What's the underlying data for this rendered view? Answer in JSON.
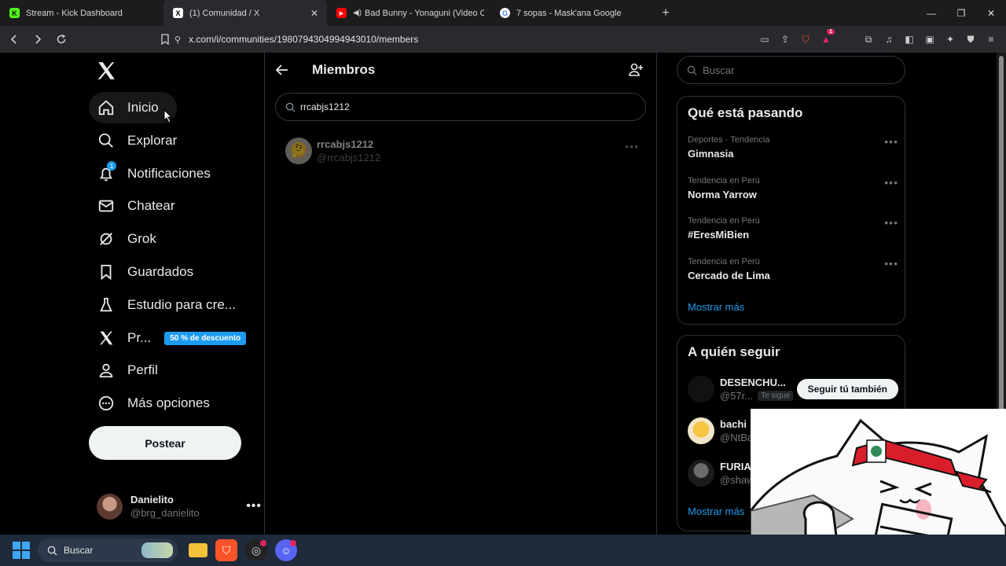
{
  "browser": {
    "tabs": [
      {
        "title": "Stream - Kick Dashboard",
        "favicon": "kick-icon",
        "color": "#53fc18",
        "active": false
      },
      {
        "title": "(1) Comunidad / X",
        "favicon": "x-icon",
        "color": "#ffffff",
        "active": true
      },
      {
        "title": "Bad Bunny - Yonaguni (Video Ofi",
        "favicon": "youtube-icon",
        "color": "#ff0000",
        "active": false
      },
      {
        "title": "7 sopas - Mask'ana Google",
        "favicon": "google-icon",
        "color": "#4285f4",
        "active": false
      }
    ],
    "url": "x.com/i/communities/1980794304994943010/members",
    "shield_badge": "1"
  },
  "nav": {
    "items": [
      {
        "label": "Inicio",
        "icon": "home-icon"
      },
      {
        "label": "Explorar",
        "icon": "search-icon"
      },
      {
        "label": "Notificaciones",
        "icon": "bell-icon",
        "badge": "1"
      },
      {
        "label": "Chatear",
        "icon": "mail-icon"
      },
      {
        "label": "Grok",
        "icon": "grok-icon"
      },
      {
        "label": "Guardados",
        "icon": "bookmark-icon"
      },
      {
        "label": "Estudio para cre...",
        "icon": "flask-icon"
      },
      {
        "label": "Pr...",
        "icon": "x-icon",
        "promo": "50 % de descuento"
      },
      {
        "label": "Perfil",
        "icon": "person-icon"
      },
      {
        "label": "Más opciones",
        "icon": "more-circle-icon"
      }
    ],
    "post_label": "Postear",
    "profile": {
      "name": "Danielito",
      "handle": "@brg_danielito"
    }
  },
  "center": {
    "title": "Miembros",
    "search_value": "rrcabjs1212",
    "member": {
      "name": "rrcabjs1212",
      "handle": "@rrcabjs1212"
    }
  },
  "right": {
    "search_placeholder": "Buscar",
    "trends_title": "Qué está pasando",
    "trends": [
      {
        "meta": "Deportes · Tendencia",
        "name": "Gimnasia"
      },
      {
        "meta": "Tendencia en Perú",
        "name": "Norma Yarrow"
      },
      {
        "meta": "Tendencia en Perú",
        "name": "#EresMiBien"
      },
      {
        "meta": "Tendencia en Perú",
        "name": "Cercado de Lima"
      }
    ],
    "show_more": "Mostrar más",
    "follow_title": "A quién seguir",
    "follow": [
      {
        "name": "DESENCHU...",
        "handle": "@57r...",
        "tag": "Te sigue",
        "button": "Seguir tú también"
      },
      {
        "name": "bachi",
        "handle": "@NtBa"
      },
      {
        "name": "FURIA",
        "handle": "@shaw"
      }
    ],
    "show_more_2": "Mostrar más"
  },
  "taskbar": {
    "search_placeholder": "Buscar"
  },
  "colors": {
    "accent": "#1d9bf0",
    "background": "#000000",
    "border": "#2f3336"
  }
}
